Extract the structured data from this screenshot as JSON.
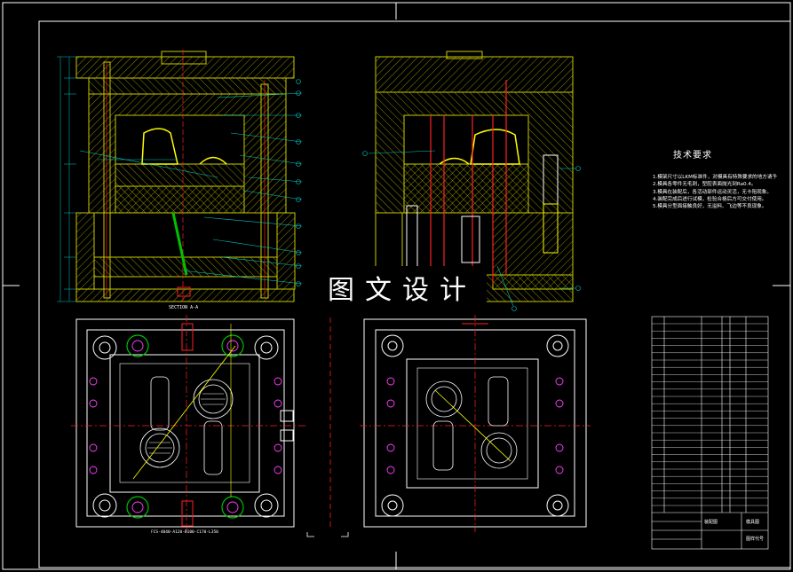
{
  "watermark": "图文设计",
  "technical_requirements": {
    "title": "技术要求",
    "lines": [
      "1.模架尺寸以LKM标准件，对模具有特殊要求的地方请予以说明。",
      "2.模具各零件无毛刺，型腔表面抛光到Ra0.4。",
      "3.模具在装配后，各活动部件运动灵活，无卡阻现象。",
      "4.装配完成后进行试模，检验合格后方可交付使用。",
      "5.模具分型面接触良好，无溢料、飞边等不良现象。"
    ]
  },
  "section_label": "SECTION A-A",
  "bottom_label": "FCS-4040-A120-B100-C170-L350",
  "title_block": {
    "name_left": "装配图",
    "name_right": "模具图",
    "drawing_no": "图样代号"
  },
  "colors": {
    "background": "#000000",
    "outline": "#ffffff",
    "hatch": "#c8c800",
    "leader": "#00c8c8",
    "part_yellow": "#ffff00",
    "green": "#00c000",
    "red": "#ff2020",
    "magenta": "#ff40ff",
    "cyan": "#00e0e0"
  }
}
